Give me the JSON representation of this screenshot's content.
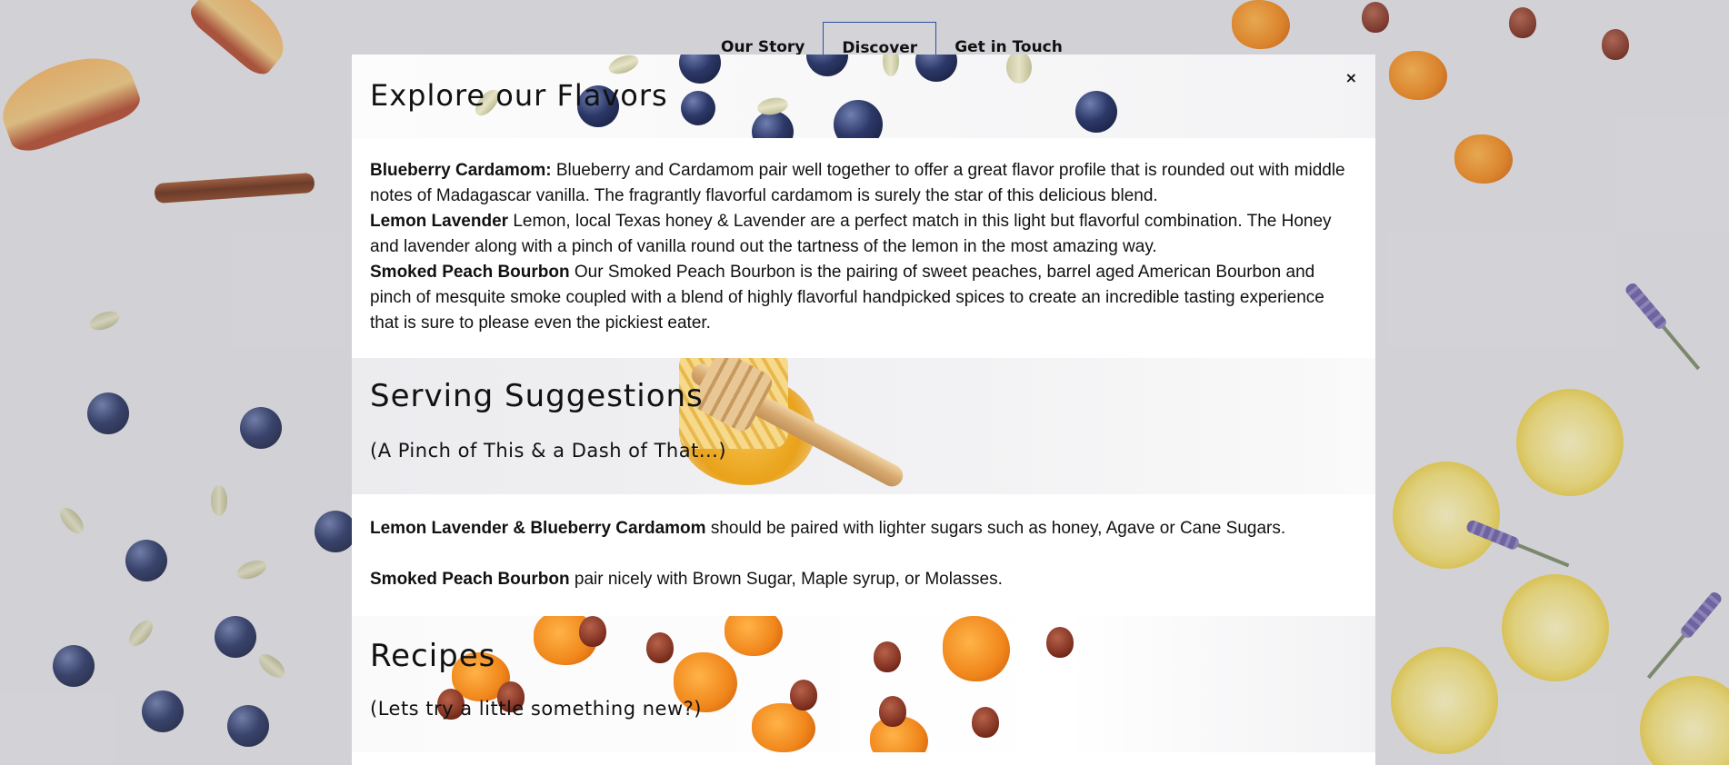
{
  "nav": {
    "items": [
      "Our Story",
      "Discover",
      "Get in Touch"
    ],
    "active": "Discover"
  },
  "modal": {
    "close_label": "×",
    "flavors": {
      "title": "Explore our Flavors",
      "items": [
        {
          "name": "Blueberry Cardamom:",
          "text": " Blueberry and Cardamom pair well together to offer a great flavor profile that is rounded out with middle notes of Madagascar vanilla. The fragrantly flavorful cardamom is surely the star of this delicious blend."
        },
        {
          "name": "Lemon Lavender",
          "text": " Lemon, local Texas honey & Lavender are a perfect match in this light but flavorful combination. The Honey and lavender along with a pinch of vanilla round out the tartness of the lemon in the most amazing way."
        },
        {
          "name": "Smoked Peach Bourbon",
          "text": " Our Smoked Peach Bourbon is the pairing of sweet peaches, barrel aged American Bourbon and pinch of mesquite smoke coupled with a blend of highly flavorful handpicked spices to create an incredible tasting experience that is sure to please even the pickiest eater."
        }
      ]
    },
    "serving": {
      "title": "Serving Suggestions",
      "subtitle": "(A Pinch of This & a Dash of That...)",
      "items": [
        {
          "name": "Lemon Lavender & Blueberry Cardamom",
          "text": " should be paired with lighter sugars such as honey, Agave or Cane Sugars."
        },
        {
          "name": "Smoked Peach Bourbon",
          "text": " pair nicely with Brown Sugar, Maple syrup, or Molasses."
        }
      ]
    },
    "recipes": {
      "title": "Recipes",
      "subtitle": "(Lets try a little something new?)"
    }
  },
  "colors": {
    "nav_active_border": "#2d4fa8",
    "modal_bg": "#ffffff",
    "text": "#111111"
  }
}
